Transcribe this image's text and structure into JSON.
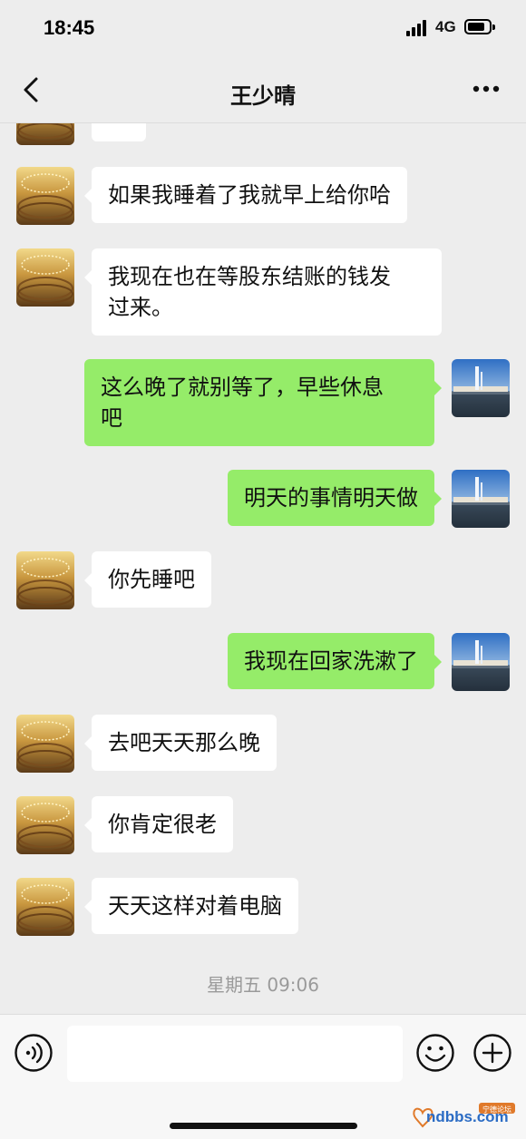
{
  "status_bar": {
    "time": "18:45",
    "network": "4G"
  },
  "header": {
    "title": "王少晴"
  },
  "messages": [
    {
      "side": "in",
      "text": "…"
    },
    {
      "side": "in",
      "text": "如果我睡着了我就早上给你哈"
    },
    {
      "side": "in",
      "text": "我现在也在等股东结账的钱发\n过来。"
    },
    {
      "side": "out",
      "text": "这么晚了就别等了，早些休息\n吧"
    },
    {
      "side": "out",
      "text": "明天的事情明天做"
    },
    {
      "side": "in",
      "text": "你先睡吧"
    },
    {
      "side": "out",
      "text": "我现在回家洗漱了"
    },
    {
      "side": "in",
      "text": "去吧天天那么晚"
    },
    {
      "side": "in",
      "text": "你肯定很老"
    },
    {
      "side": "in",
      "text": "天天这样对着电脑"
    }
  ],
  "timestamp": "星期五 09:06",
  "input": {
    "value": "",
    "placeholder": ""
  },
  "watermark": {
    "text": "ndbbs.com",
    "tag": "宁德论坛"
  },
  "icons": {
    "back": "chevron-left-icon",
    "more": "more-dots-icon",
    "voice": "voice-icon",
    "emoji": "emoji-icon",
    "plus": "plus-icon"
  },
  "colors": {
    "background": "#ededed",
    "bubble_in": "#ffffff",
    "bubble_out": "#95ec69",
    "timestamp": "#9a9a9a"
  }
}
